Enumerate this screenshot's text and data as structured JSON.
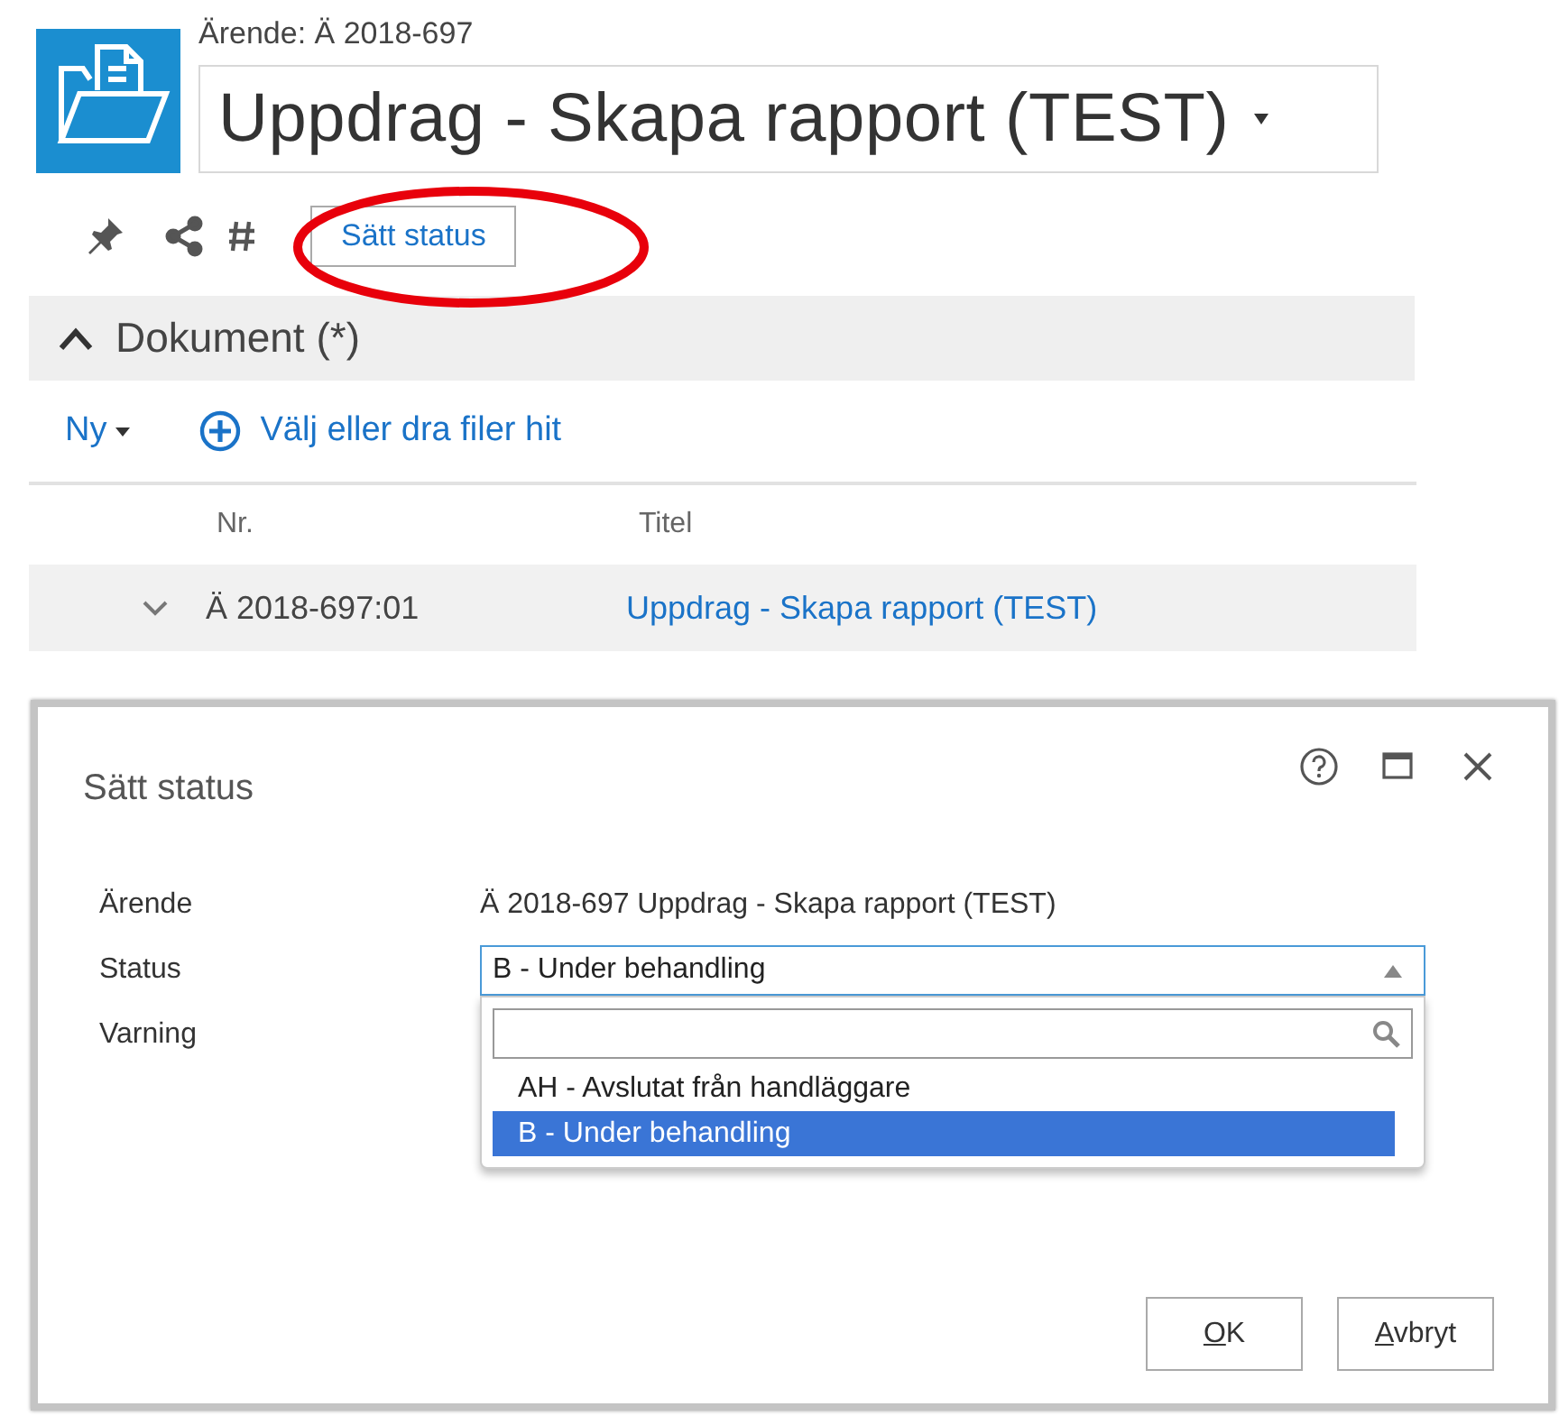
{
  "case_header": {
    "label": "Ärende: Ä 2018-697",
    "title": "Uppdrag - Skapa rapport (TEST)"
  },
  "toolbar": {
    "set_status_button": "Sätt status"
  },
  "documents": {
    "header": "Dokument (*)",
    "expanded": true,
    "new_menu": "Ny",
    "upload_link": "Välj eller dra filer hit",
    "columns": [
      "Nr.",
      "Titel"
    ],
    "rows": [
      {
        "nr": "Ä 2018-697:01",
        "title": "Uppdrag - Skapa rapport (TEST)",
        "expanded": false
      }
    ]
  },
  "dialog": {
    "title": "Sätt status",
    "fields": [
      {
        "label": "Ärende",
        "kind": "text",
        "value": "Ä 2018-697 Uppdrag - Skapa rapport (TEST)"
      },
      {
        "label": "Status",
        "kind": "dropdown",
        "value": "B - Under behandling",
        "open": true,
        "options": [
          {
            "label": "AH - Avslutat från handläggare",
            "selected": false
          },
          {
            "label": "B - Under behandling",
            "selected": true
          }
        ]
      },
      {
        "label": "Varning",
        "kind": "empty"
      }
    ],
    "buttons": [
      {
        "label": "OK"
      },
      {
        "label": "Avbryt"
      }
    ]
  }
}
